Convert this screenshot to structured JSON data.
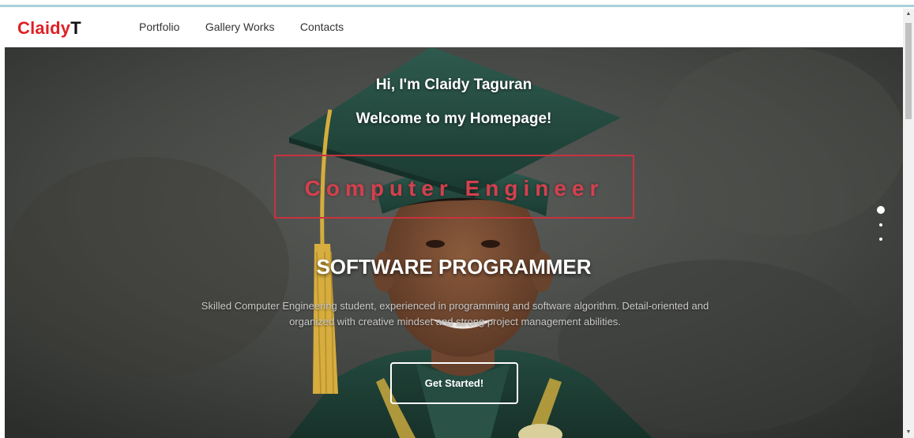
{
  "brand": {
    "part1": "Claidy",
    "part2": "T"
  },
  "nav": {
    "items": [
      {
        "label": "Portfolio"
      },
      {
        "label": "Gallery Works"
      },
      {
        "label": "Contacts"
      }
    ]
  },
  "hero": {
    "greeting": "Hi, I'm Claidy Taguran",
    "welcome": "Welcome to my Homepage!",
    "role": "Computer Engineer",
    "headline": "SOFTWARE PROGRAMMER",
    "description": "Skilled Computer Engineering student, experienced in programming and software algorithm. Detail-oriented and organized with creative mindset and strong project management abilities.",
    "cta_label": "Get Started!",
    "slides_count": 3,
    "active_slide": 1
  },
  "colors": {
    "brand_red": "#e02027",
    "role_red": "#d4404e",
    "background": "#3e403e",
    "gown_green": "#1e3f35"
  },
  "scrollbar": {
    "up_icon": "triangle-up-icon",
    "down_icon": "triangle-down-icon"
  }
}
